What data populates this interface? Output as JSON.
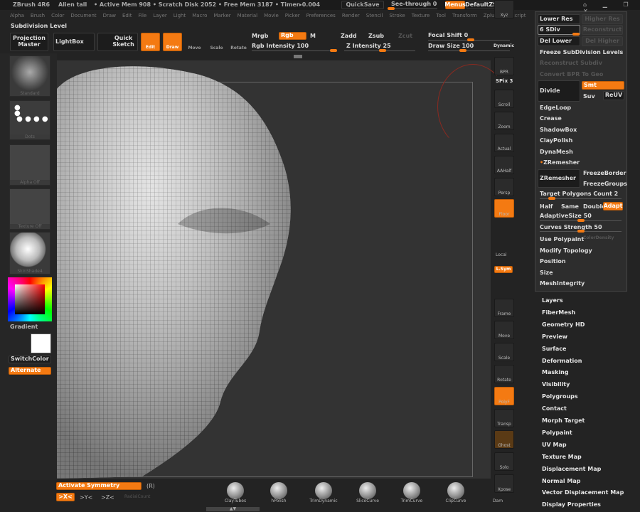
{
  "titlebar": {
    "app": "ZBrush 4R6",
    "doc": "Alien tall",
    "status": "• Active Mem 908 • Scratch Disk 2052 • Free Mem 3187 • Timer▸0.004",
    "quicksave": "QuickSave",
    "see_through": "See-through  0",
    "menus": "Menus",
    "script": "DefaultZScript"
  },
  "menubar": [
    "Alpha",
    "Brush",
    "Color",
    "Document",
    "Draw",
    "Edit",
    "File",
    "Layer",
    "Light",
    "Macro",
    "Marker",
    "Material",
    "Movie",
    "Picker",
    "Preferences",
    "Render",
    "Stencil",
    "Stroke",
    "Texture",
    "Tool",
    "Transform",
    "Zplugin",
    "Zscript"
  ],
  "toolbar": {
    "subdiv_label": "Subdivision Level",
    "projection": "Projection Master",
    "lightbox": "LightBox",
    "quick_sketch": "Quick Sketch",
    "edit": "Edit",
    "draw": "Draw",
    "move": "Move",
    "scale": "Scale",
    "rotate": "Rotate",
    "mrgb": "Mrgb",
    "rgb": "Rgb",
    "m": "M",
    "rgb_intensity": "Rgb Intensity 100",
    "zadd": "Zadd",
    "zsub": "Zsub",
    "zcut": "Zcut",
    "z_intensity": "Z Intensity 25",
    "focal_shift": "Focal Shift 0",
    "draw_size": "Draw Size 100",
    "dynamic": "Dynamic",
    "rgb_intensity_value": 100,
    "z_intensity_value": 25,
    "draw_size_value": 100
  },
  "left_shelf": {
    "brush": "Standard",
    "stroke": "Dots",
    "alpha": "Alpha Off",
    "texture": "Texture Off",
    "material": "SkinShade4",
    "gradient": "Gradient",
    "switch_color": "SwitchColor",
    "alternate": "Alternate"
  },
  "right_shelf": [
    "BPR",
    "SPix 3",
    "Scroll",
    "Zoom",
    "Actual",
    "AAHalf",
    "Persp",
    "Floor",
    "Local",
    "L.Sym",
    "Xyz",
    "Frame",
    "Move",
    "Scale",
    "Rotate",
    "PolyF",
    "Transp",
    "Ghost",
    "Solo",
    "Xpose"
  ],
  "geometry_panel": {
    "lower_res": "Lower Res",
    "higher_res": "Higher Res",
    "sdiv": "6 SDiv",
    "reconstruct": "Reconstruct",
    "del_lower": "Del Lower",
    "del_higher": "Del Higher",
    "freeze": "Freeze SubDivision Levels",
    "reconstruct_subdiv": "Reconstruct Subdiv",
    "convert_bpr": "Convert BPR To Geo",
    "divide": "Divide",
    "smt": "Smt",
    "suv": "Suv",
    "reuv": "ReUV",
    "edgeloop": "EdgeLoop",
    "crease": "Crease",
    "shadowbox": "ShadowBox",
    "claypolish": "ClayPolish",
    "dynamesh": "DynaMesh",
    "zremesher_header": "ZRemesher",
    "zremesher_btn": "ZRemesher",
    "freeze_border": "FreezeBorder",
    "freeze_groups": "FreezeGroups",
    "target_polys": "Target Polygons Count 2",
    "half": "Half",
    "same": "Same",
    "double": "Double",
    "adapt": "Adapt",
    "adaptive_size": "AdaptiveSize 50",
    "curves_strength": "Curves Strength 50",
    "use_polypaint": "Use Polypaint",
    "color_density": "ColorDensity",
    "modify_topology": "Modify Topology",
    "position": "Position",
    "size": "Size",
    "mesh_integrity": "MeshIntegrity"
  },
  "palettes": [
    "Layers",
    "FiberMesh",
    "Geometry HD",
    "Preview",
    "Surface",
    "Deformation",
    "Masking",
    "Visibility",
    "Polygroups",
    "Contact",
    "Morph Target",
    "Polypaint",
    "UV Map",
    "Texture Map",
    "Displacement Map",
    "Normal Map",
    "Vector Displacement Map",
    "Display Properties"
  ],
  "bottom": {
    "activate_symmetry": "Activate Symmetry",
    "hotkey": "(R)",
    "x": ">X<",
    "y": ">Y<",
    "z": ">Z<",
    "radial": "RadialCount",
    "brushes": [
      "ClayTubes",
      "hPolish",
      "TrimDynamic",
      "SliceCurve",
      "TrimCurve",
      "ClipCurve",
      "Dam"
    ]
  },
  "colors": {
    "accent": "#f47a12",
    "bg": "#232323",
    "canvas": "#343434"
  }
}
